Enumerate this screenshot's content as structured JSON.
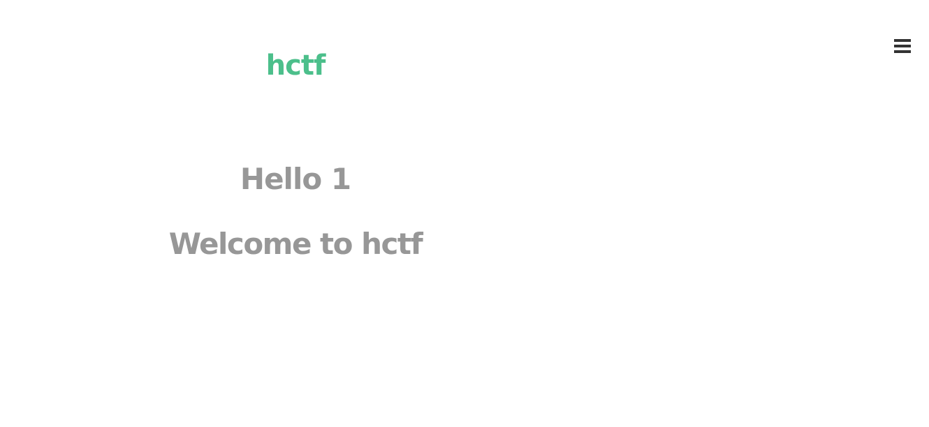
{
  "header": {
    "brand": "hctf",
    "menu_icon": "hamburger-menu-icon",
    "brand_color": "#4cbf8b"
  },
  "main": {
    "greeting": "Hello 1",
    "welcome": "Welcome to hctf",
    "text_color": "#979797"
  }
}
